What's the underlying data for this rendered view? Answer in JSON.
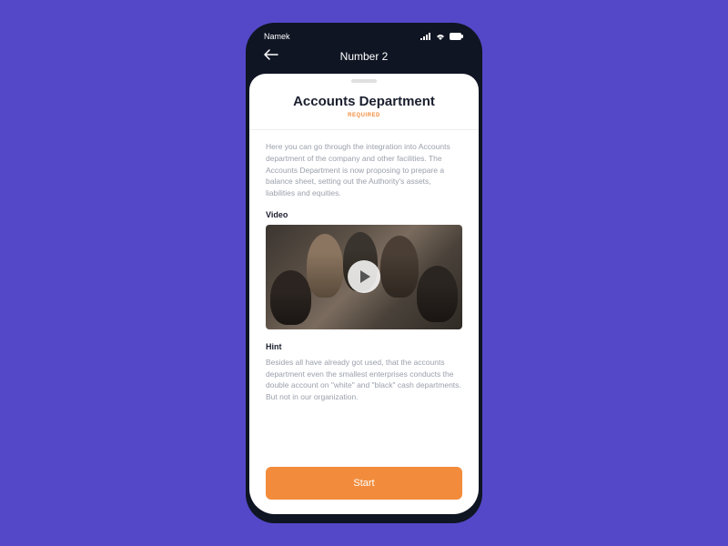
{
  "statusBar": {
    "carrier": "Namek"
  },
  "nav": {
    "title": "Number 2"
  },
  "header": {
    "title": "Accounts Department",
    "badge": "REQUIRED"
  },
  "body": {
    "description": "Here you can go through the integration into Accounts department of the company and other facilities. The Accounts Department is now proposing to prepare a balance sheet, setting out the Authority's assets, liabilities and equities.",
    "videoLabel": "Video",
    "hintLabel": "Hint",
    "hintText": "Besides all have already got used, that the accounts department even the smallest enterprises conducts the double account on \"white\" and \"black\" cash departments. But not in our organization."
  },
  "actions": {
    "startLabel": "Start"
  },
  "colors": {
    "background": "#5448C8",
    "phone": "#0F1523",
    "accent": "#F28C3C"
  }
}
